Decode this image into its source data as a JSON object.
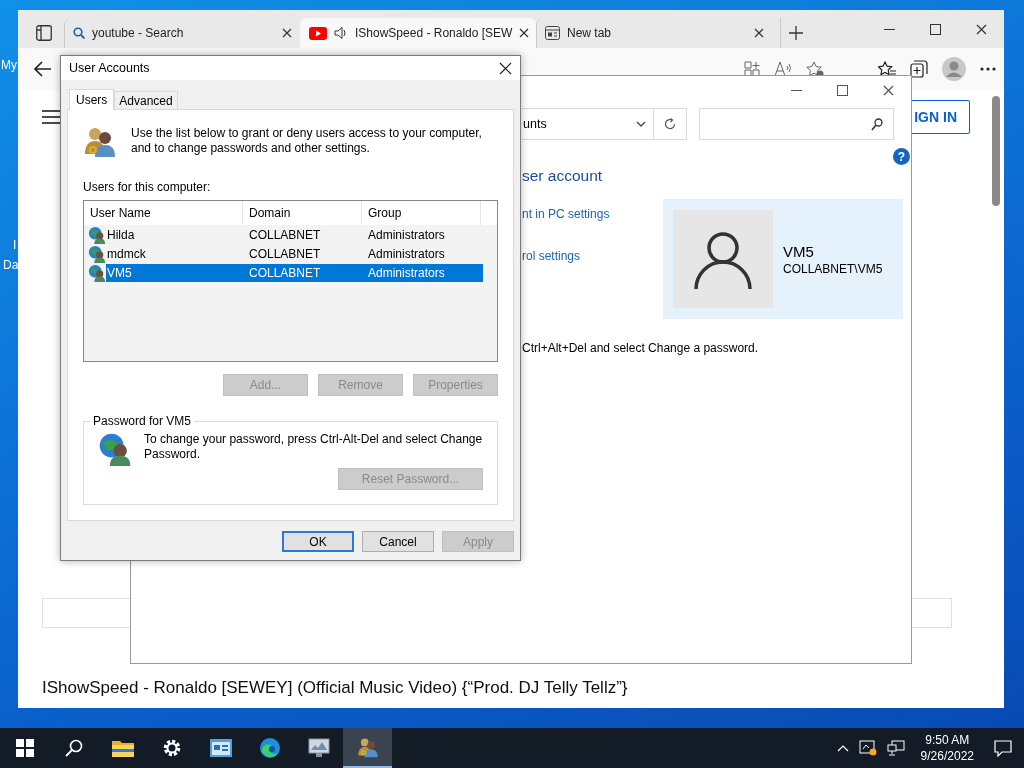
{
  "desktop": {
    "labels": [
      "My",
      "I",
      "Da"
    ]
  },
  "browser": {
    "tabs": [
      {
        "kind": "search",
        "title": "youtube - Search",
        "selected": false,
        "audio": false
      },
      {
        "kind": "video",
        "title": "IShowSpeed - Ronaldo [SEW",
        "selected": true,
        "audio": true
      },
      {
        "kind": "page",
        "title": "New tab",
        "selected": false,
        "audio": false
      }
    ],
    "page": {
      "sign_in": "IGN IN",
      "video_title": "IShowSpeed - Ronaldo [SEWEY] (Official Music Video) {“Prod. DJ Telly Tellz”}"
    }
  },
  "control_panel": {
    "address": "unts",
    "help": "?",
    "heading": "ser account",
    "links": [
      "nt in PC settings",
      "rol settings"
    ],
    "user": {
      "name": "VM5",
      "account": "COLLABNET\\VM5"
    },
    "note": "Ctrl+Alt+Del and select Change a password."
  },
  "dialog": {
    "title": "User Accounts",
    "tabs": [
      {
        "label": "Users",
        "selected": true
      },
      {
        "label": "Advanced",
        "selected": false
      }
    ],
    "intro": "Use the list below to grant or deny users access to your computer, and to change passwords and other settings.",
    "list_label": "Users for this computer:",
    "columns": [
      "User Name",
      "Domain",
      "Group"
    ],
    "rows": [
      {
        "user": "Hilda",
        "domain": "COLLABNET",
        "group": "Administrators",
        "selected": false
      },
      {
        "user": "mdmck",
        "domain": "COLLABNET",
        "group": "Administrators",
        "selected": false
      },
      {
        "user": "VM5",
        "domain": "COLLABNET",
        "group": "Administrators",
        "selected": true
      }
    ],
    "list_buttons": [
      {
        "label": "Add...",
        "disabled": true
      },
      {
        "label": "Remove",
        "disabled": true
      },
      {
        "label": "Properties",
        "disabled": true
      }
    ],
    "password_group": {
      "title": "Password for VM5",
      "text": "To change your password, press Ctrl-Alt-Del and select Change Password.",
      "button": {
        "label": "Reset Password...",
        "disabled": true
      }
    },
    "footer_buttons": [
      {
        "label": "OK",
        "default": true,
        "disabled": false
      },
      {
        "label": "Cancel",
        "default": false,
        "disabled": false
      },
      {
        "label": "Apply",
        "default": false,
        "disabled": true
      }
    ]
  },
  "taskbar": {
    "apps": [
      {
        "kind": "start",
        "selected": false
      },
      {
        "kind": "search",
        "selected": false
      },
      {
        "kind": "folder",
        "selected": false
      },
      {
        "kind": "gear",
        "selected": false
      },
      {
        "kind": "panel",
        "selected": false
      },
      {
        "kind": "edge",
        "selected": false
      },
      {
        "kind": "monitor",
        "selected": false
      },
      {
        "kind": "users",
        "selected": true
      }
    ],
    "time": "9:50 AM",
    "date": "9/26/2022"
  }
}
